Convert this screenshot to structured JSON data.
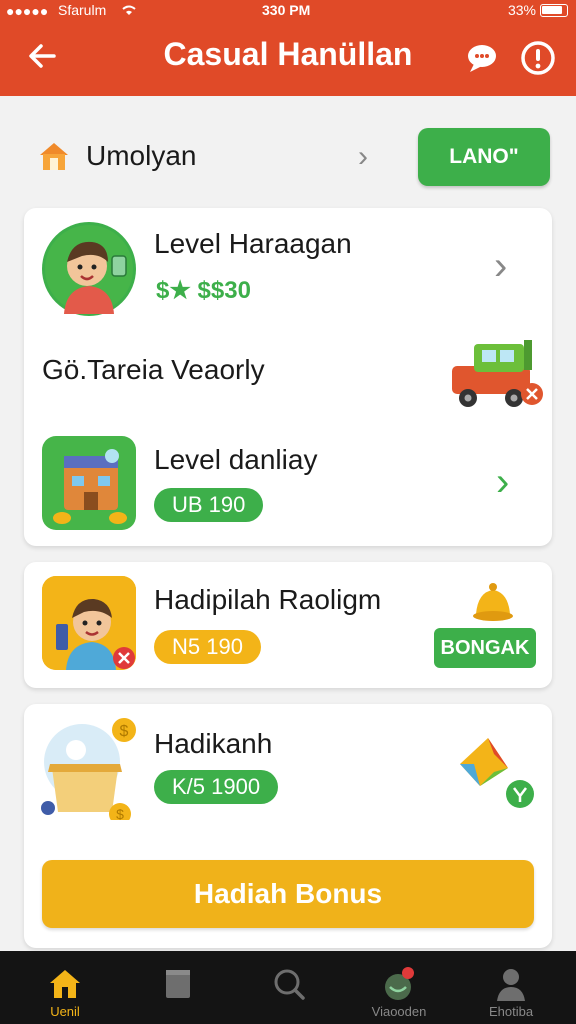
{
  "status_bar": {
    "carrier": "Sfarulm",
    "time": "330 PM",
    "battery": "33%"
  },
  "app_bar": {
    "title": "Casual Hanüllan",
    "back_icon": "arrow-left-icon",
    "chat_icon": "chat-bubble-icon",
    "info_icon": "alert-circle-icon"
  },
  "section": {
    "label": "Umolyan",
    "button_label": "LANO\""
  },
  "card_levels": {
    "level_1": {
      "title": "Level Haraagan",
      "price": "$★ $$30"
    },
    "subheading": "Gö.Tareia Veaorly",
    "level_2": {
      "title": "Level danliay",
      "badge": "UB 190"
    }
  },
  "card_reward_1": {
    "title": "Hadipilah Raoligm",
    "badge": "N5 190",
    "button_label": "BONGAK"
  },
  "card_reward_2": {
    "title": "Hadikanh",
    "badge": "K/5 1900",
    "button_label": "Hadiah Bonus"
  },
  "tabs": [
    {
      "label": "Uenil",
      "icon": "home-icon",
      "active": true
    },
    {
      "label": "",
      "icon": "book-icon",
      "active": false
    },
    {
      "label": "",
      "icon": "search-icon",
      "active": false
    },
    {
      "label": "Viaooden",
      "icon": "reward-icon",
      "active": false
    },
    {
      "label": "Ehotiba",
      "icon": "profile-icon",
      "active": false
    }
  ],
  "colors": {
    "primary": "#e04a28",
    "green": "#3daf4a",
    "yellow": "#f3b418"
  }
}
